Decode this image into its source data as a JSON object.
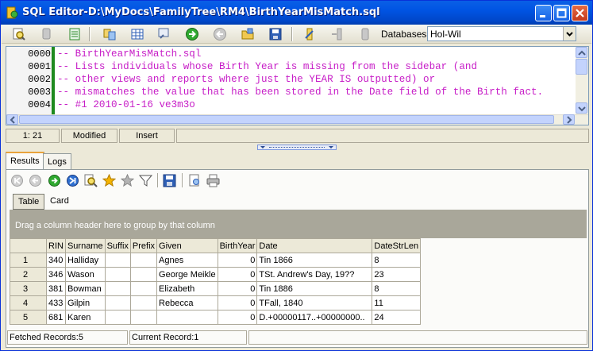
{
  "window": {
    "title": "SQL Editor-D:\\MyDocs\\FamilyTree\\RM4\\BirthYearMisMatch.sql"
  },
  "toolbar": {
    "databases_label": "Databases",
    "database_selected": "Hol-Wil"
  },
  "editor": {
    "lines": [
      {
        "no": "0000",
        "text": "-- BirthYearMisMatch.sql"
      },
      {
        "no": "0001",
        "text": "-- Lists individuals whose Birth Year is missing from the sidebar (and"
      },
      {
        "no": "0002",
        "text": "-- other views and reports where just the YEAR IS outputted) or"
      },
      {
        "no": "0003",
        "text": "-- mismatches the value that has been stored in the Date field of the Birth fact."
      },
      {
        "no": "0004",
        "text": "-- #1 2010-01-16 ve3m3o"
      }
    ]
  },
  "editor_status": {
    "position": "1: 21",
    "state": "Modified",
    "mode": "Insert"
  },
  "tabs": {
    "results": "Results",
    "logs": "Logs"
  },
  "view_tabs": {
    "table": "Table",
    "card": "Card"
  },
  "grid": {
    "group_hint": "Drag a column header here to group by that column",
    "columns": [
      "RIN",
      "Surname",
      "Suffix",
      "Prefix",
      "Given",
      "BirthYear",
      "Date",
      "DateStrLen"
    ],
    "rows": [
      {
        "no": "1",
        "RIN": "340",
        "Surname": "Halliday",
        "Suffix": "",
        "Prefix": "",
        "Given": "Agnes",
        "BirthYear": "0",
        "Date": "Tin 1866",
        "DateStrLen": "8"
      },
      {
        "no": "2",
        "RIN": "346",
        "Surname": "Wason",
        "Suffix": "",
        "Prefix": "",
        "Given": "George Meikle",
        "BirthYear": "0",
        "Date": "TSt. Andrew's Day, 19??",
        "DateStrLen": "23"
      },
      {
        "no": "3",
        "RIN": "381",
        "Surname": "Bowman",
        "Suffix": "",
        "Prefix": "",
        "Given": "Elizabeth",
        "BirthYear": "0",
        "Date": "Tin 1886",
        "DateStrLen": "8"
      },
      {
        "no": "4",
        "RIN": "433",
        "Surname": "Gilpin",
        "Suffix": "",
        "Prefix": "",
        "Given": "Rebecca",
        "BirthYear": "0",
        "Date": "TFall, 1840",
        "DateStrLen": "11"
      },
      {
        "no": "5",
        "RIN": "681",
        "Surname": "Karen",
        "Suffix": "",
        "Prefix": "",
        "Given": "",
        "BirthYear": "0",
        "Date": "D.+00000117..+00000000..",
        "DateStrLen": "24"
      }
    ]
  },
  "status": {
    "fetched": "Fetched Records:5",
    "current": "Current Record:1"
  }
}
